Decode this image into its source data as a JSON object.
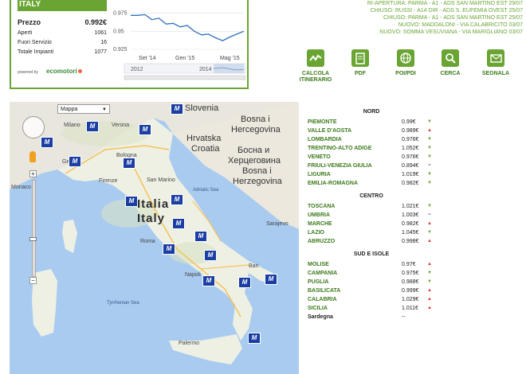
{
  "summary": {
    "country": "ITALY",
    "stats": [
      {
        "label": "Prezzo",
        "value": "0.992€",
        "main": true
      },
      {
        "label": "Aperti",
        "value": "1061",
        "main": false
      },
      {
        "label": "Fuori Servizio",
        "value": "16",
        "main": false
      },
      {
        "label": "Totale Impianti",
        "value": "1077",
        "main": false
      }
    ],
    "powered_by": "powered by",
    "logo_text": "ecomotori"
  },
  "chart_data": {
    "type": "line",
    "title": "",
    "xlabel": "",
    "ylabel": "",
    "y_ticks": [
      "0.975",
      "0.95",
      "0.925"
    ],
    "ylim": [
      0.925,
      0.98
    ],
    "x_ticks": [
      "Set '14",
      "Gen '15",
      "Mag '15"
    ],
    "navigator_labels": [
      "2012",
      "2014"
    ],
    "series": [
      {
        "values": [
          0.972,
          0.972,
          0.973,
          0.966,
          0.968,
          0.96,
          0.961,
          0.956,
          0.958,
          0.95,
          0.945,
          0.946,
          0.941,
          0.937,
          0.942,
          0.946,
          0.95
        ]
      }
    ]
  },
  "notices": [
    "RI-APERTURA: PARMA - A1 - ADS SAN MARTINO EST 29/07",
    "CHIUSO: RUSSI - A14 DIR - ADS S. EUFEMIA OVEST 25/07",
    "CHIUSO: PARMA - A1 - ADS SAN MARTINO EST 25/07",
    "NUOVO: MADDALONI - VIA CALABRICITO 03/07",
    "NUOVO: SOMMA VESUVIANA - VIA MARIGLIANO 03/07"
  ],
  "actions": [
    {
      "label": "CALCOLA ITINERARIO",
      "icon": "route-icon"
    },
    {
      "label": "PDF",
      "icon": "pdf-icon"
    },
    {
      "label": "POI/PDI",
      "icon": "globe-icon"
    },
    {
      "label": "CERCA",
      "icon": "search-icon"
    },
    {
      "label": "SEGNALA",
      "icon": "envelope-icon"
    }
  ],
  "map": {
    "type_select": "Mappa",
    "labels": {
      "slovenia": "Slovenia",
      "hrvatska": "Hrvatska",
      "croatia": "Croatia",
      "bosna1": "Bosna i",
      "hercegovina": "Hercegovina",
      "bosna_cyr1": "Босна и",
      "bosna_cyr2": "Херцеговина",
      "bosna2": "Bosna i",
      "hercegovina2": "Herzegovina",
      "italia": "Italia",
      "italy": "Italy",
      "san_marino": "San Marino",
      "monaco": "Monaco",
      "milano": "Milano",
      "verona": "Verona",
      "genova": "Genova",
      "bologna": "Bologna",
      "firenze": "Firenze",
      "roma": "Roma",
      "napoli": "Napoli",
      "bari": "Bari",
      "palermo": "Palermo",
      "tyrrhenian": "Tyrrhenian Sea",
      "adriatic": "Adriatic Sea",
      "sarajevo": "Sarajevo"
    }
  },
  "prices": {
    "sections": [
      {
        "title": "NORD",
        "rows": [
          {
            "region": "PIEMONTE",
            "price": "0.99€",
            "trend": "down"
          },
          {
            "region": "VALLE D'AOSTA",
            "price": "0.989€",
            "trend": "up"
          },
          {
            "region": "LOMBARDIA",
            "price": "0.976€",
            "trend": "down"
          },
          {
            "region": "TRENTINO-ALTO ADIGE",
            "price": "1.052€",
            "trend": "down"
          },
          {
            "region": "VENETO",
            "price": "0.976€",
            "trend": "down"
          },
          {
            "region": "FRIULI-VENEZIA GIULIA",
            "price": "0.894€",
            "trend": "eq"
          },
          {
            "region": "LIGURIA",
            "price": "1.019€",
            "trend": "down"
          },
          {
            "region": "EMILIA-ROMAGNA",
            "price": "0.982€",
            "trend": "down"
          }
        ]
      },
      {
        "title": "CENTRO",
        "rows": [
          {
            "region": "TOSCANA",
            "price": "1.021€",
            "trend": "down"
          },
          {
            "region": "UMBRIA",
            "price": "1.003€",
            "trend": "eq"
          },
          {
            "region": "MARCHE",
            "price": "0.982€",
            "trend": "up"
          },
          {
            "region": "LAZIO",
            "price": "1.045€",
            "trend": "down"
          },
          {
            "region": "ABRUZZO",
            "price": "0.998€",
            "trend": "up"
          }
        ]
      },
      {
        "title": "SUD E ISOLE",
        "rows": [
          {
            "region": "MOLISE",
            "price": "0.97€",
            "trend": "up"
          },
          {
            "region": "CAMPANIA",
            "price": "0.975€",
            "trend": "down"
          },
          {
            "region": "PUGLIA",
            "price": "0.988€",
            "trend": "down"
          },
          {
            "region": "BASILICATA",
            "price": "0.999€",
            "trend": "up"
          },
          {
            "region": "CALABRIA",
            "price": "1.029€",
            "trend": "up"
          },
          {
            "region": "SICILIA",
            "price": "1.011€",
            "trend": "up"
          },
          {
            "region": "Sardegna",
            "price": "--",
            "trend": "none"
          }
        ]
      }
    ]
  }
}
